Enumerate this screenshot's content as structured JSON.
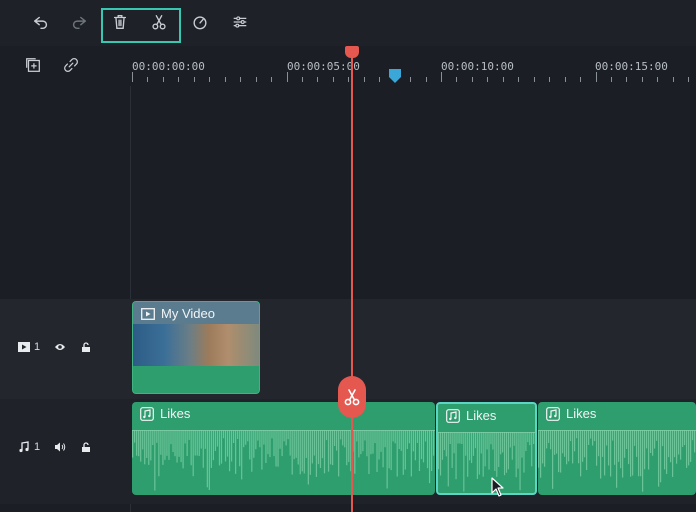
{
  "toolbar": {
    "undo_icon": "undo-icon",
    "redo_icon": "redo-icon",
    "delete_icon": "trash-icon",
    "split_icon": "scissors-icon",
    "speed_icon": "speed-icon",
    "adjust_icon": "adjust-icon",
    "highlight_color": "#38c7b0"
  },
  "ruler": {
    "timecodes": [
      "00:00:00:00",
      "00:00:05:00",
      "00:00:10:00",
      "00:00:15:00"
    ]
  },
  "tracks": {
    "video": {
      "label": "1",
      "clip_name": "My Video"
    },
    "audio": {
      "label": "1",
      "clips": [
        "Likes",
        "Likes",
        "Likes"
      ]
    }
  },
  "colors": {
    "playhead": "#e5584f",
    "clip_green": "#2e9e6e",
    "marker_blue": "#3aa7d8"
  }
}
